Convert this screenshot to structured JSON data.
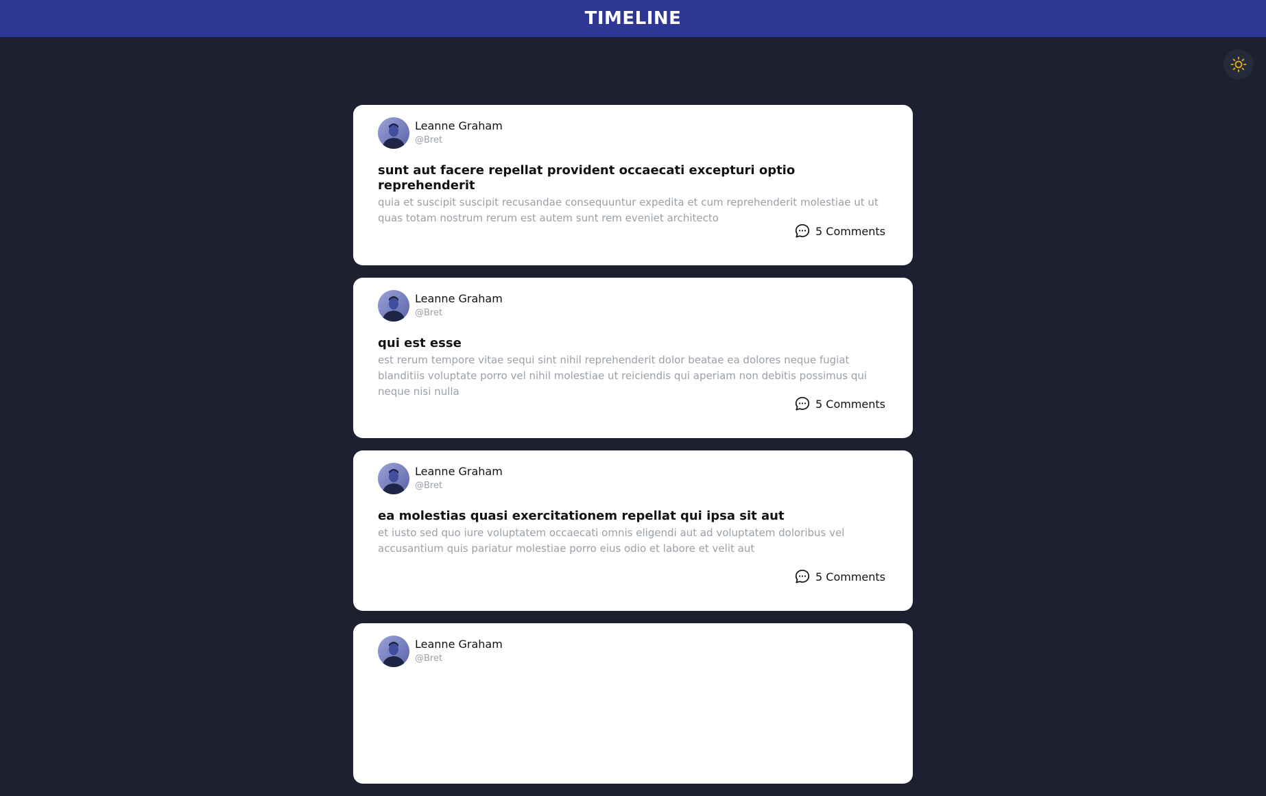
{
  "header": {
    "title": "TIMELINE"
  },
  "theme_toggle": {
    "icon": "sun-icon",
    "color": "#e7b416"
  },
  "colors": {
    "header_bg": "#2e3793",
    "page_bg": "#1c2030",
    "card_bg": "#ffffff",
    "muted_text": "#9aa0a8"
  },
  "posts": [
    {
      "user": {
        "name": "Leanne Graham",
        "handle": "@Bret"
      },
      "title": "sunt aut facere repellat provident occaecati excepturi optio reprehenderit",
      "body": "quia et suscipit suscipit recusandae consequuntur expedita et cum reprehenderit molestiae ut ut quas totam nostrum rerum est autem sunt rem eveniet architecto",
      "comments_label": "5 Comments"
    },
    {
      "user": {
        "name": "Leanne Graham",
        "handle": "@Bret"
      },
      "title": "qui est esse",
      "body": "est rerum tempore vitae sequi sint nihil reprehenderit dolor beatae ea dolores neque fugiat blanditiis voluptate porro vel nihil molestiae ut reiciendis qui aperiam non debitis possimus qui neque nisi nulla",
      "comments_label": "5 Comments"
    },
    {
      "user": {
        "name": "Leanne Graham",
        "handle": "@Bret"
      },
      "title": "ea molestias quasi exercitationem repellat qui ipsa sit aut",
      "body": "et iusto sed quo iure voluptatem occaecati omnis eligendi aut ad voluptatem doloribus vel accusantium quis pariatur molestiae porro eius odio et labore et velit aut",
      "comments_label": "5 Comments"
    },
    {
      "user": {
        "name": "Leanne Graham",
        "handle": "@Bret"
      },
      "title": "",
      "body": "",
      "comments_label": ""
    }
  ]
}
